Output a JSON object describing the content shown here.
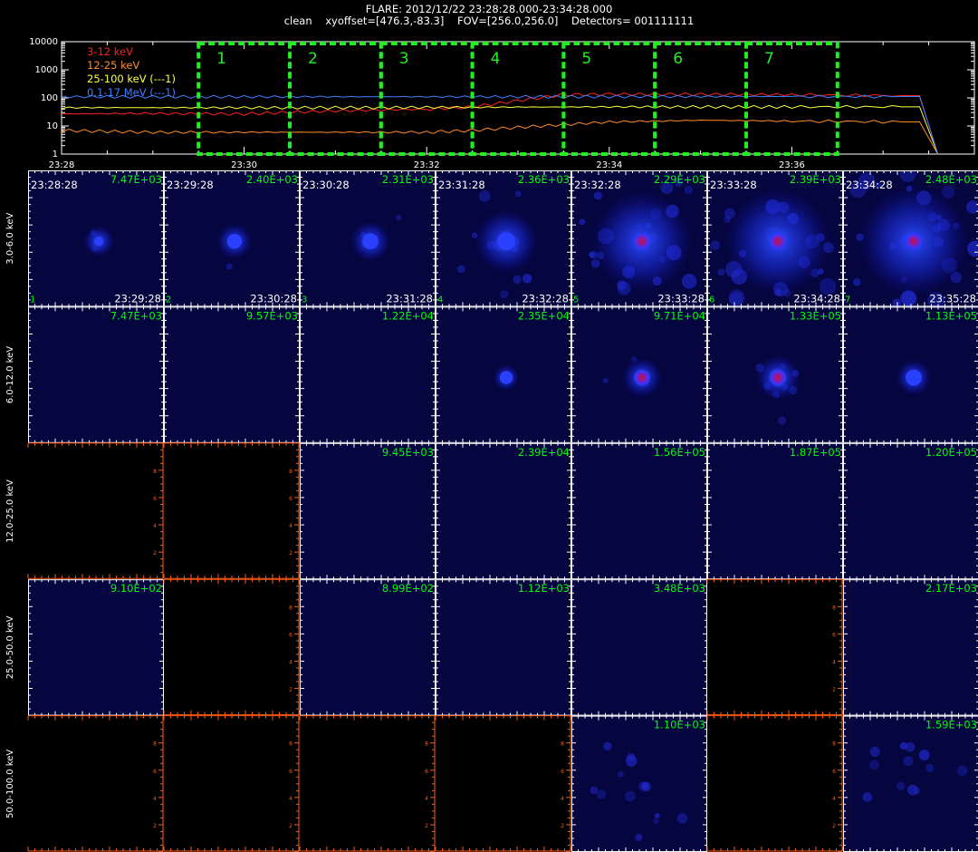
{
  "header": {
    "line1": "FLARE: 2012/12/22 23:28:28.000-23:34:28.000",
    "line2": "clean    xyoffset=[476.3,-83.3]    FOV=[256.0,256.0]    Detectors= 001111111"
  },
  "chart_data": {
    "type": "line",
    "yscale": "log",
    "ylim": [
      1,
      10000
    ],
    "y_ticks": [
      "1",
      "10",
      "100",
      "1000",
      "10000"
    ],
    "x_ticks": [
      "23:28",
      "23:30",
      "23:32",
      "23:34",
      "23:36"
    ],
    "x_range_minutes": [
      0,
      10
    ],
    "legend_placement": "top-left",
    "series": [
      {
        "name": "3-12 keV",
        "color": "#ff2020",
        "x": [
          0,
          1,
          2,
          3,
          4,
          4.5,
          5,
          5.5,
          6,
          7,
          8,
          9.2,
          9.4,
          9.6
        ],
        "y": [
          27,
          28,
          27,
          35,
          40,
          48,
          80,
          130,
          135,
          135,
          130,
          120,
          120,
          1
        ]
      },
      {
        "name": "12-25 keV",
        "color": "#ff8c2a",
        "x": [
          0,
          1,
          2,
          3,
          4,
          4.5,
          5,
          6,
          7,
          8,
          9.2,
          9.4,
          9.6
        ],
        "y": [
          7,
          6,
          6,
          6,
          6,
          7,
          9,
          14,
          16,
          15,
          14,
          14,
          1
        ]
      },
      {
        "name": "25-100 keV (---1)",
        "color": "#ffff40",
        "x": [
          0,
          1,
          2,
          3,
          4,
          5,
          6,
          7,
          8,
          9.2,
          9.4,
          9.6
        ],
        "y": [
          45,
          45,
          45,
          45,
          46,
          47,
          48,
          48,
          48,
          48,
          48,
          1
        ]
      },
      {
        "name": "0.1-17 MeV (---1)",
        "color": "#3f7fff",
        "x": [
          0,
          1,
          2,
          3,
          4,
          5,
          6,
          7,
          8,
          9.2,
          9.4,
          9.6
        ],
        "y": [
          110,
          110,
          110,
          110,
          110,
          110,
          112,
          112,
          112,
          112,
          112,
          1
        ]
      }
    ],
    "intervals": [
      {
        "label": "1",
        "start": 1.5,
        "end": 2.5
      },
      {
        "label": "2",
        "start": 2.5,
        "end": 3.5
      },
      {
        "label": "3",
        "start": 3.5,
        "end": 4.5
      },
      {
        "label": "4",
        "start": 4.5,
        "end": 5.5
      },
      {
        "label": "5",
        "start": 5.5,
        "end": 6.5
      },
      {
        "label": "6",
        "start": 6.5,
        "end": 7.5
      },
      {
        "label": "7",
        "start": 7.5,
        "end": 8.5
      }
    ],
    "image_grid": {
      "energy_bands": [
        "3.0-6.0 keV",
        "6.0-12.0 keV",
        "12.0-25.0 keV",
        "25.0-50.0 keV",
        "50.0-100.0 keV"
      ],
      "interval_starts": [
        "23:28:28",
        "23:29:28",
        "23:30:28",
        "23:31:28",
        "23:32:28",
        "23:33:28",
        "23:34:28"
      ],
      "interval_ends": [
        "23:29:28",
        "23:30:28",
        "23:31:28",
        "23:32:28",
        "23:33:28",
        "23:34:28",
        "23:35:28"
      ],
      "interval_numbers": [
        "1",
        "2",
        "3",
        "4",
        "5",
        "6",
        "7"
      ],
      "empty_axis_ticks": [
        "2",
        "4",
        "6",
        "8"
      ],
      "cells": [
        [
          {
            "max": "7.47E+03",
            "kind": "image",
            "source": 0.15,
            "halo": 0.1,
            "noise": 0.05
          },
          {
            "max": "2.40E+03",
            "kind": "image",
            "source": 0.6,
            "halo": 0.15,
            "noise": 0.05
          },
          {
            "max": "2.31E+03",
            "kind": "image",
            "source": 0.7,
            "halo": 0.2,
            "noise": 0.1
          },
          {
            "max": "2.36E+03",
            "kind": "image",
            "source": 0.85,
            "halo": 0.45,
            "noise": 0.35
          },
          {
            "max": "2.29E+03",
            "kind": "image",
            "source": 1.0,
            "halo": 0.85,
            "noise": 0.6
          },
          {
            "max": "2.39E+03",
            "kind": "image",
            "source": 1.0,
            "halo": 0.9,
            "noise": 0.65
          },
          {
            "max": "2.48E+03",
            "kind": "image",
            "source": 1.0,
            "halo": 0.95,
            "noise": 0.7
          }
        ],
        [
          {
            "max": "7.47E+03",
            "kind": "image",
            "source": 0,
            "halo": 0,
            "noise": 0
          },
          {
            "max": "9.57E+03",
            "kind": "image",
            "source": 0,
            "halo": 0,
            "noise": 0
          },
          {
            "max": "1.22E+04",
            "kind": "image",
            "source": 0,
            "halo": 0,
            "noise": 0
          },
          {
            "max": "2.35E+04",
            "kind": "image",
            "source": 0.45,
            "halo": 0.05,
            "noise": 0
          },
          {
            "max": "9.71E+04",
            "kind": "image",
            "source": 0.9,
            "halo": 0.2,
            "noise": 0.05
          },
          {
            "max": "1.33E+05",
            "kind": "image",
            "source": 0.95,
            "halo": 0.25,
            "noise": 0.2
          },
          {
            "max": "1.13E+05",
            "kind": "image",
            "source": 0.7,
            "halo": 0.15,
            "noise": 0
          }
        ],
        [
          {
            "max": "",
            "kind": "empty"
          },
          {
            "max": "",
            "kind": "empty"
          },
          {
            "max": "9.45E+03",
            "kind": "image",
            "source": 0,
            "halo": 0,
            "noise": 0
          },
          {
            "max": "2.39E+04",
            "kind": "image",
            "source": 0,
            "halo": 0,
            "noise": 0
          },
          {
            "max": "1.56E+05",
            "kind": "image",
            "source": 0,
            "halo": 0,
            "noise": 0
          },
          {
            "max": "1.87E+05",
            "kind": "image",
            "source": 0,
            "halo": 0,
            "noise": 0
          },
          {
            "max": "1.20E+05",
            "kind": "image",
            "source": 0,
            "halo": 0,
            "noise": 0
          }
        ],
        [
          {
            "max": "9.10E+02",
            "kind": "image",
            "source": 0,
            "halo": 0,
            "noise": 0
          },
          {
            "max": "",
            "kind": "empty"
          },
          {
            "max": "8.99E+02",
            "kind": "image",
            "source": 0,
            "halo": 0,
            "noise": 0
          },
          {
            "max": "1.12E+03",
            "kind": "image",
            "source": 0,
            "halo": 0,
            "noise": 0
          },
          {
            "max": "3.48E+03",
            "kind": "image",
            "source": 0,
            "halo": 0,
            "noise": 0
          },
          {
            "max": "",
            "kind": "empty"
          },
          {
            "max": "2.17E+03",
            "kind": "image",
            "source": 0,
            "halo": 0,
            "noise": 0
          }
        ],
        [
          {
            "max": "",
            "kind": "empty"
          },
          {
            "max": "",
            "kind": "empty"
          },
          {
            "max": "",
            "kind": "empty"
          },
          {
            "max": "",
            "kind": "empty"
          },
          {
            "max": "1.10E+03",
            "kind": "image",
            "source": 0,
            "halo": 0,
            "noise": 0.35
          },
          {
            "max": "",
            "kind": "empty"
          },
          {
            "max": "1.59E+03",
            "kind": "image",
            "source": 0,
            "halo": 0,
            "noise": 0.3
          }
        ]
      ]
    }
  },
  "colors": {
    "background": "#000000",
    "cell_fill": "#05053f",
    "axis_white": "#ffffff",
    "empty_axis": "#ff5a14",
    "label_green": "#00ff00",
    "interval_box": "#22ee22",
    "hot_core": "#c01040"
  }
}
